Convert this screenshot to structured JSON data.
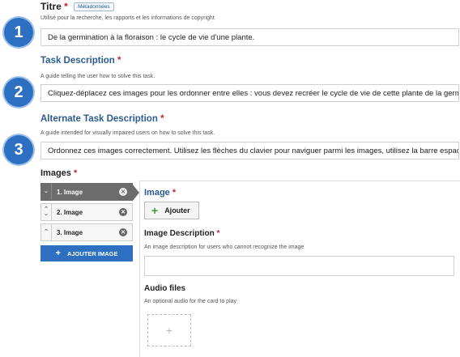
{
  "step_badges": [
    "1",
    "2",
    "3"
  ],
  "title_field": {
    "label": "Titre",
    "required_mark": "*",
    "metadata_button": "Métadonnées",
    "hint": "Utilisé pour la recherche, les rapports et les informations de copyright",
    "value": "De la germination à la floraison : le cycle de vie d'une plante."
  },
  "task_description": {
    "label": "Task Description",
    "required_mark": "*",
    "hint": "A guide telling the user how to solve this task.",
    "value": "Cliquez-déplacez ces images pour les ordonner entre elles : vous devez recréer le cycle de vie de cette plante de la germinati"
  },
  "alt_task_description": {
    "label": "Alternate Task Description",
    "required_mark": "*",
    "hint": "A guide intended for visually impaired users on how to solve this task.",
    "value": "Ordonnez ces images correctement. Utilisez les flèches du clavier pour naviguer parmi les images, utilisez la barre espace pou"
  },
  "images": {
    "label": "Images",
    "required_mark": "*",
    "tabs": [
      {
        "label": "1. Image",
        "active": true
      },
      {
        "label": "2. Image",
        "active": false
      },
      {
        "label": "3. Image",
        "active": false
      }
    ],
    "add_button": "AJOUTER IMAGE"
  },
  "image_panel": {
    "image_label": "Image",
    "required_mark": "*",
    "add_button": "Ajouter",
    "desc_label": "Image Description",
    "desc_required_mark": "*",
    "desc_hint": "An image description for users who cannot recognize the image",
    "desc_value": "",
    "audio_label": "Audio files",
    "audio_hint": "An optional audio for the card to play",
    "audio_add_symbol": "+"
  },
  "colors": {
    "accent": "#2d6fc0",
    "required": "#c0262d",
    "label_blue": "#2c5b8f"
  }
}
